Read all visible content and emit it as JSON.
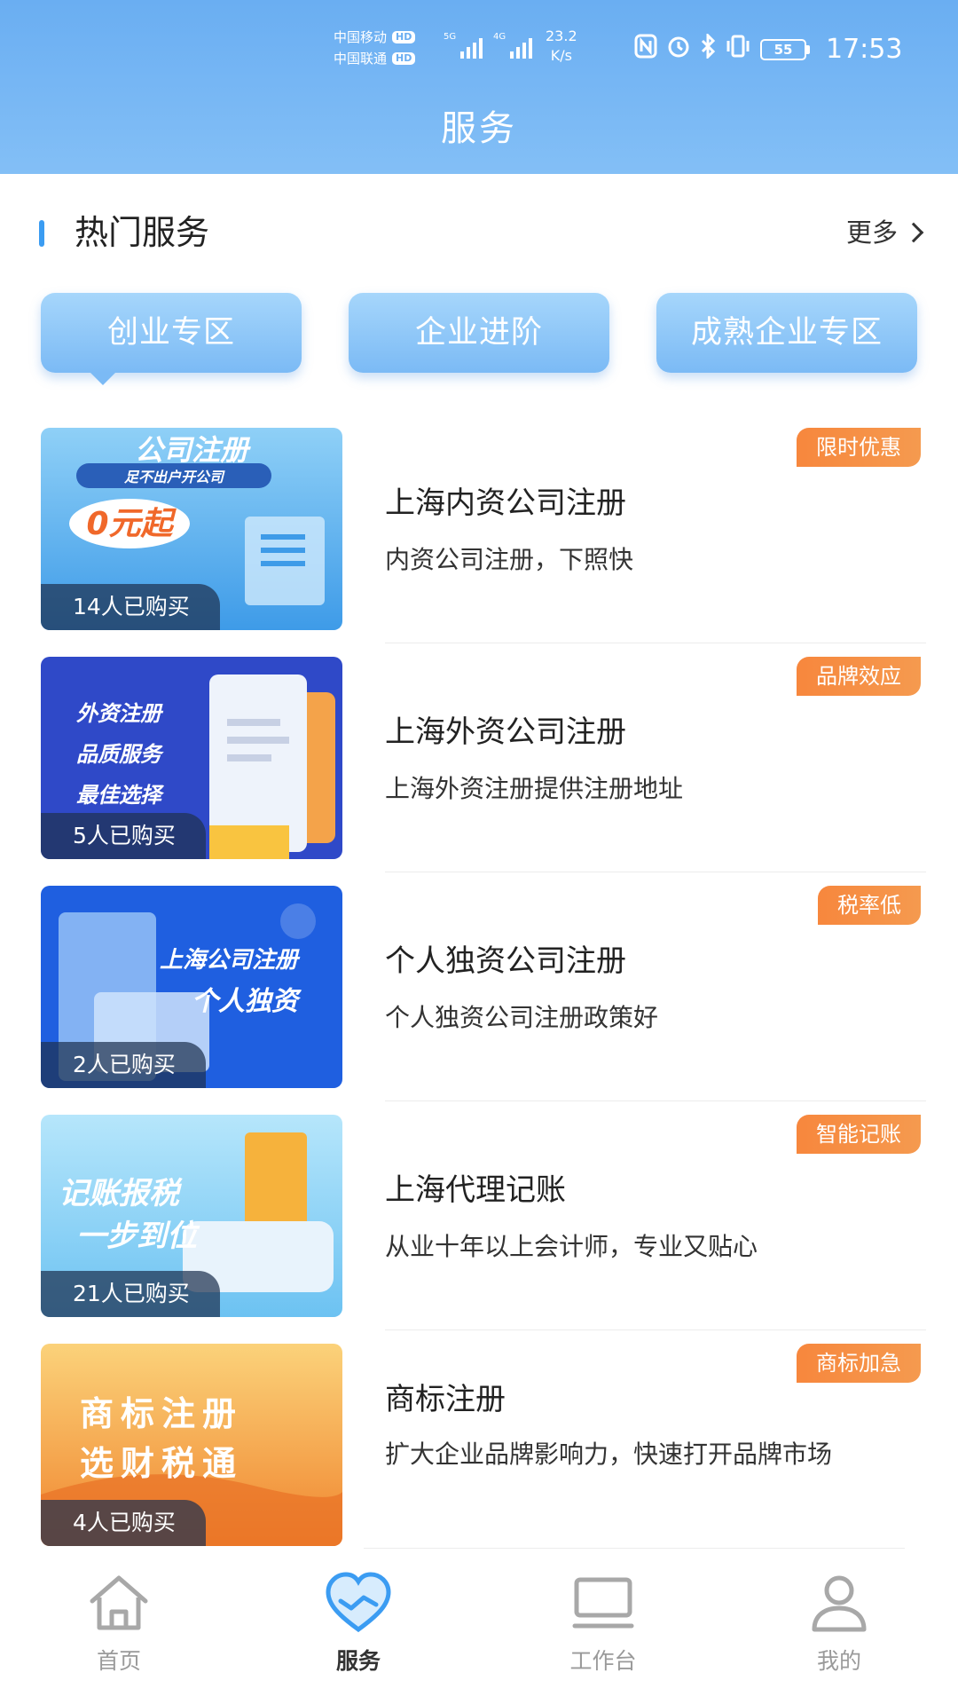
{
  "status_bar": {
    "carrier1": "中国移动",
    "carrier2": "中国联通",
    "hd": "HD",
    "net1": "5G",
    "net2": "4G",
    "speed_value": "23.2",
    "speed_unit": "K/s",
    "battery": "55",
    "time": "17:53"
  },
  "header": {
    "title": "服务"
  },
  "section": {
    "title": "热门服务",
    "more_label": "更多"
  },
  "tabs": [
    {
      "label": "创业专区",
      "active": true
    },
    {
      "label": "企业进阶",
      "active": false
    },
    {
      "label": "成熟企业专区",
      "active": false
    }
  ],
  "services": [
    {
      "title": "上海内资公司注册",
      "desc": "内资公司注册，下照快",
      "badge": "限时优惠",
      "buyers": "14人已购买",
      "thumb_text1": "公司注册",
      "thumb_text2": "足不出户开公司",
      "thumb_text3": "0元起"
    },
    {
      "title": "上海外资公司注册",
      "desc": "上海外资注册提供注册地址",
      "badge": "品牌效应",
      "buyers": "5人已购买",
      "thumb_text1": "外资注册",
      "thumb_text2": "品质服务",
      "thumb_text3": "最佳选择"
    },
    {
      "title": "个人独资公司注册",
      "desc": "个人独资公司注册政策好",
      "badge": "税率低",
      "buyers": "2人已购买",
      "thumb_text1": "上海公司注册",
      "thumb_text2": "个人独资"
    },
    {
      "title": "上海代理记账",
      "desc": "从业十年以上会计师，专业又贴心",
      "badge": "智能记账",
      "buyers": "21人已购买",
      "thumb_text1": "记账报税",
      "thumb_text2": "一步到位"
    },
    {
      "title": "商标注册",
      "desc": "扩大企业品牌影响力，快速打开品牌市场",
      "badge": "商标加急",
      "buyers": "4人已购买",
      "thumb_text1": "商标注册",
      "thumb_text2": "选财税通"
    }
  ],
  "bottom_nav": [
    {
      "label": "首页",
      "icon": "home-icon"
    },
    {
      "label": "服务",
      "icon": "service-heart-icon",
      "active": true
    },
    {
      "label": "工作台",
      "icon": "workbench-icon"
    },
    {
      "label": "我的",
      "icon": "profile-icon"
    }
  ],
  "colors": {
    "header": "#6aaef2",
    "accent": "#3b9cf2",
    "promo_badge": "#f7873d",
    "tab": "#7bbaf5"
  }
}
